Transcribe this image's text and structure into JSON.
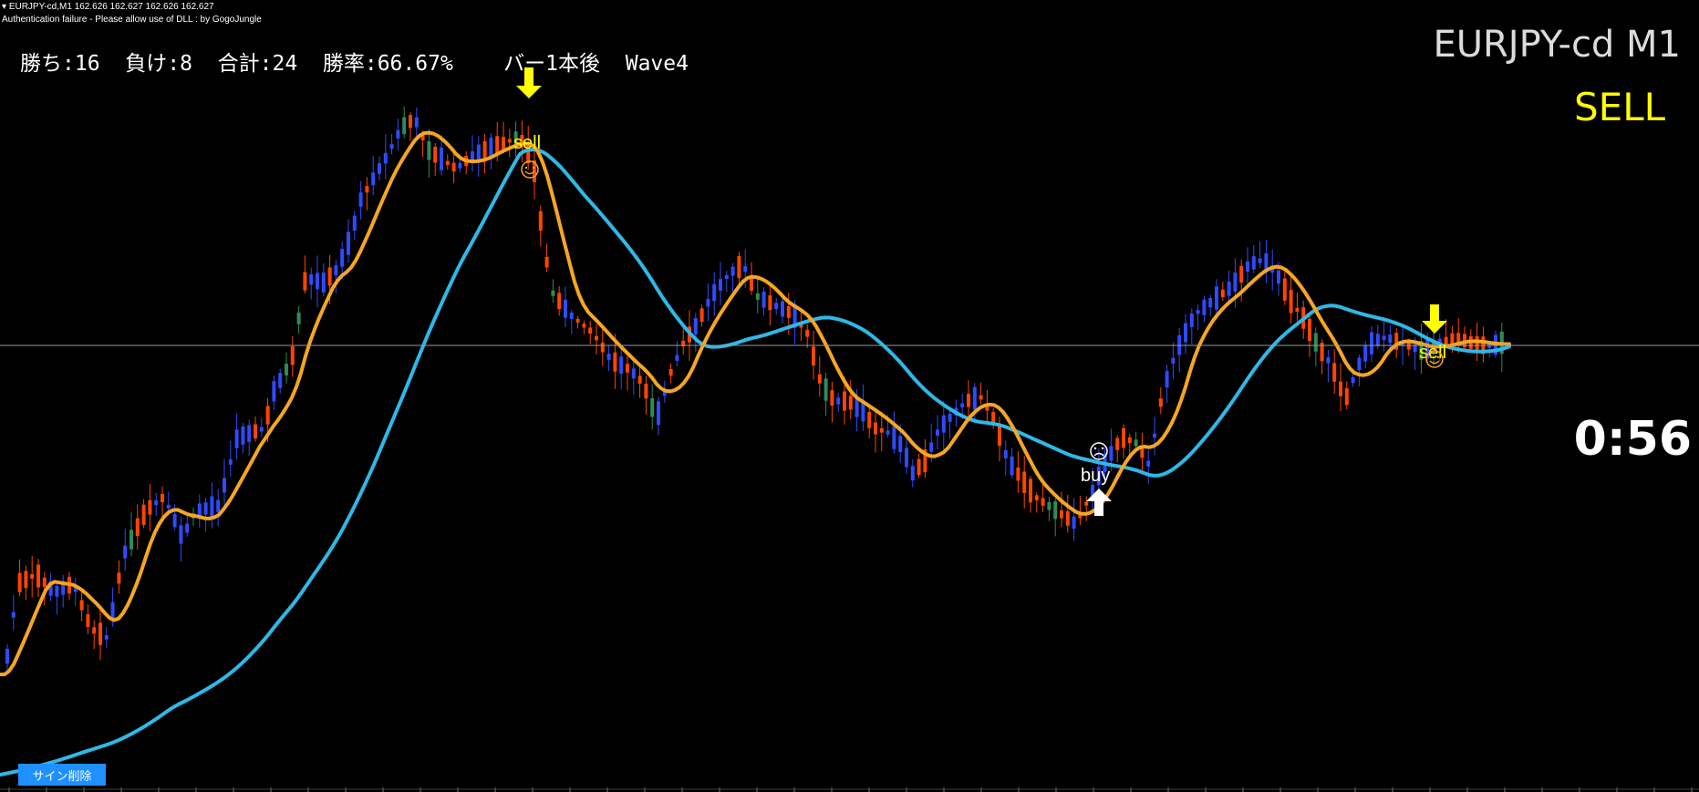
{
  "header": {
    "title_line": "EURJPY-cd,M1  162.626 162.627 162.626 162.627",
    "status_line": "Authentication failure - Please allow use of DLL : by GogoJungle",
    "collapse_icon": "triangle-down-icon"
  },
  "stats": {
    "text": "勝ち:16  負け:8  合計:24  勝率:66.67%    バー1本後  Wave4"
  },
  "symbol_label": "EURJPY-cd M1",
  "signal_label": "SELL",
  "timer": "0:56",
  "delete_button": "サイン削除",
  "signals": [
    {
      "type": "sell",
      "label": "sell",
      "arrow_icon": "arrow-down-icon",
      "face_icon": "smiley-icon"
    },
    {
      "type": "buy",
      "label": "buy",
      "arrow_icon": "arrow-up-icon",
      "face_icon": "frown-icon"
    },
    {
      "type": "sell",
      "label": "sell",
      "arrow_icon": "arrow-down-icon",
      "face_icon": "smiley-icon"
    }
  ],
  "colors": {
    "background": "#000000",
    "bull_candle": "#2e4bff",
    "bear_candle": "#ff4500",
    "doji_candle": "#2e8b57",
    "fast_ma": "#f5a623",
    "slow_ma": "#2fb8e6",
    "price_line": "#9a9a9a",
    "sell_arrow": "#ffff00",
    "buy_arrow": "#ffffff",
    "button": "#1e90ff"
  }
}
